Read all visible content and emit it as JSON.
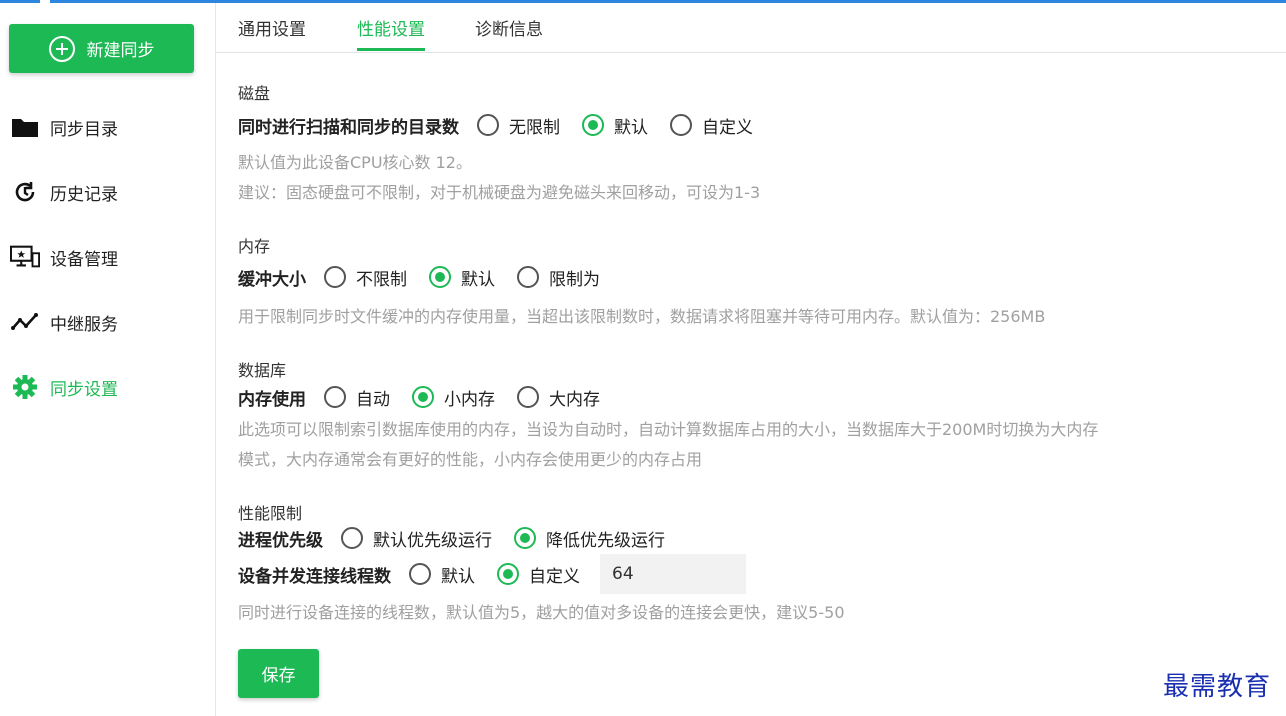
{
  "sidebar": {
    "new_button": "新建同步",
    "items": [
      {
        "label": "同步目录"
      },
      {
        "label": "历史记录"
      },
      {
        "label": "设备管理"
      },
      {
        "label": "中继服务"
      },
      {
        "label": "同步设置"
      }
    ]
  },
  "tabs": [
    "通用设置",
    "性能设置",
    "诊断信息"
  ],
  "active_tab": "性能设置",
  "disk": {
    "title": "磁盘",
    "label": "同时进行扫描和同步的目录数",
    "options": [
      "无限制",
      "默认",
      "自定义"
    ],
    "selected": "默认",
    "hint1": "默认值为此设备CPU核心数 12。",
    "hint2": "建议：固态硬盘可不限制，对于机械硬盘为避免磁头来回移动，可设为1-3"
  },
  "memory": {
    "title": "内存",
    "label": "缓冲大小",
    "options": [
      "不限制",
      "默认",
      "限制为"
    ],
    "selected": "默认",
    "hint": "用于限制同步时文件缓冲的内存使用量，当超出该限制数时，数据请求将阻塞并等待可用内存。默认值为：256MB"
  },
  "database": {
    "title": "数据库",
    "label": "内存使用",
    "options": [
      "自动",
      "小内存",
      "大内存"
    ],
    "selected": "小内存",
    "hint1": "此选项可以限制索引数据库使用的内存，当设为自动时，自动计算数据库占用的大小，当数据库大于200M时切换为大内存",
    "hint2": "模式，大内存通常会有更好的性能，小内存会使用更少的内存占用"
  },
  "performance": {
    "title": "性能限制",
    "priority_label": "进程优先级",
    "priority_options": [
      "默认优先级运行",
      "降低优先级运行"
    ],
    "priority_selected": "降低优先级运行",
    "threads_label": "设备并发连接线程数",
    "threads_options": [
      "默认",
      "自定义"
    ],
    "threads_selected": "自定义",
    "threads_value": "64",
    "hint": "同时进行设备连接的线程数，默认值为5，越大的值对多设备的连接会更快，建议5-50"
  },
  "save_button": "保存",
  "watermark": "最需教育",
  "colors": {
    "accent": "#1db954",
    "hint": "#a0a0a0",
    "top_bar": "#2e86de",
    "watermark": "#1a2fb0"
  }
}
